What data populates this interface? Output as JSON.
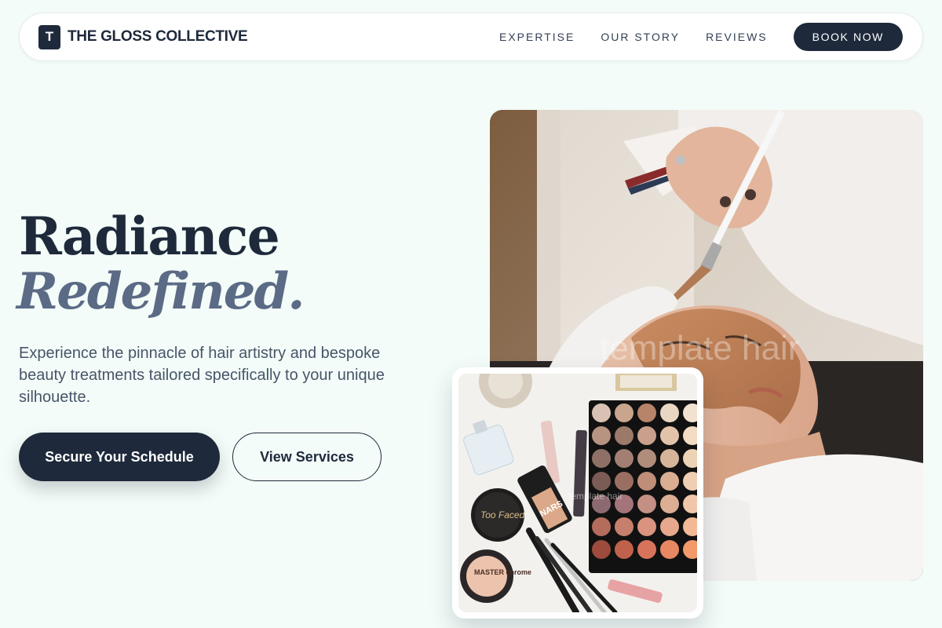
{
  "nav": {
    "logo_letter": "T",
    "brand": "THE GLOSS COLLECTIVE",
    "links": [
      "EXPERTISE",
      "OUR STORY",
      "REVIEWS"
    ],
    "cta": "BOOK NOW"
  },
  "hero": {
    "title_line1": "Radiance",
    "title_line2": "Redefined.",
    "description": "Experience the pinnacle of hair artistry and bespoke beauty treatments tailored specifically to your unique silhouette.",
    "primary_button": "Secure Your Schedule",
    "secondary_button": "View Services"
  },
  "images": {
    "main_photo": "facial-treatment-photo",
    "main_watermark": "template hair",
    "secondary_photo": "makeup-flatlay-photo",
    "secondary_watermark": "template hair",
    "compact_lid_1": "Too Faced",
    "compact_lid_2": "MASTER chrome",
    "bottle_brand": "NARS"
  },
  "colors": {
    "background": "#f3fcf8",
    "navy": "#1e293b",
    "slate_italic": "#5b6a85",
    "body_text": "#475569"
  }
}
